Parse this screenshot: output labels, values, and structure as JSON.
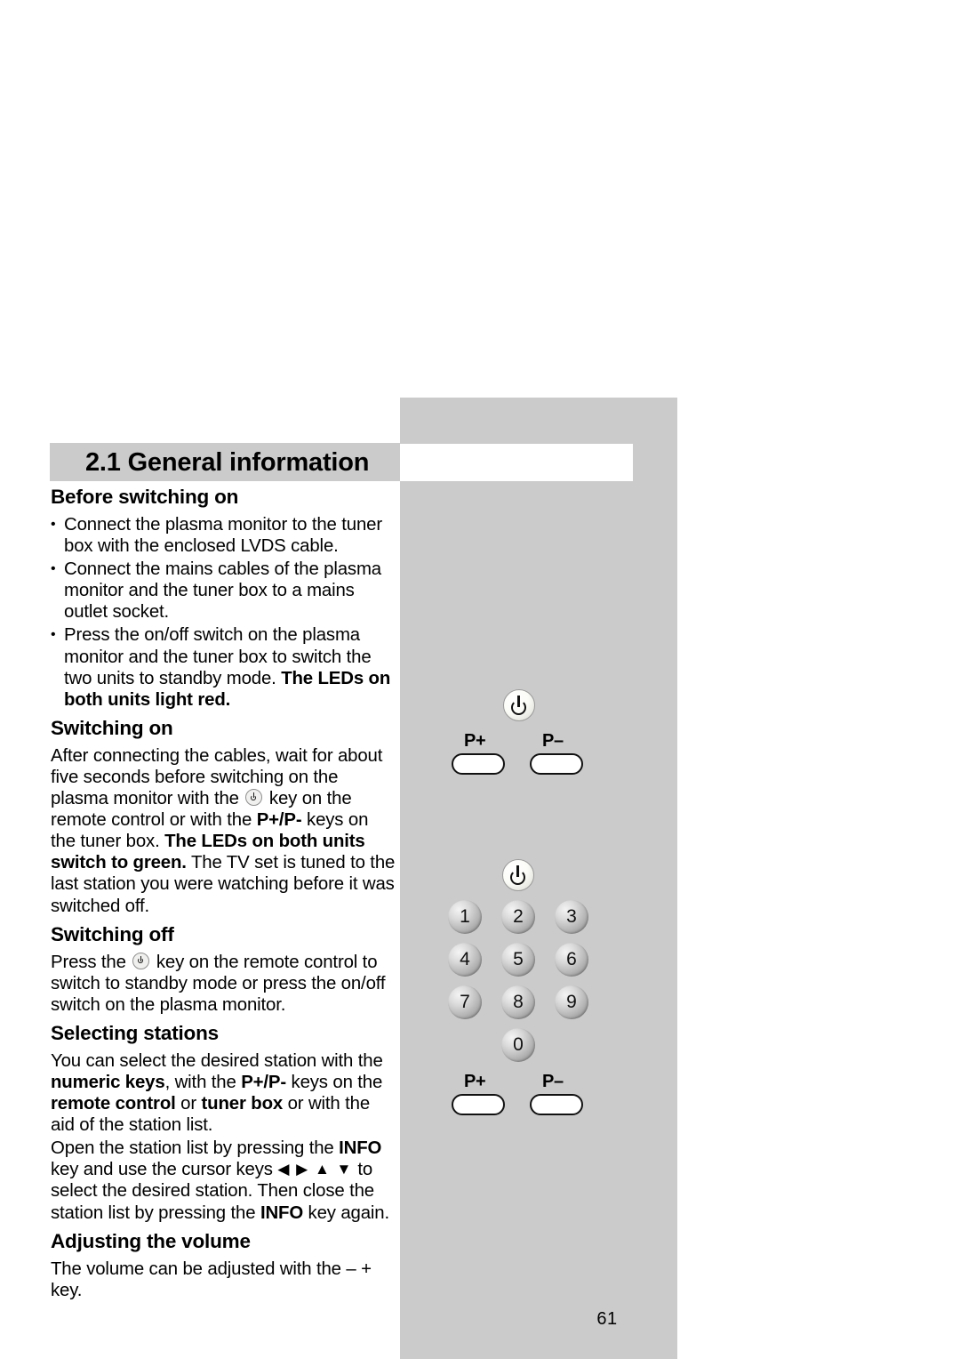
{
  "page": {
    "number": "61",
    "accent_grey": "#cbcbcb"
  },
  "heading": {
    "title": "2.1 General information"
  },
  "sections": [
    {
      "heading": "Before switching on",
      "bullets": [
        "Connect the plasma monitor to the tuner box with the enclosed LVDS cable.",
        "Connect the mains cables of the plasma monitor and the tuner box to a mains outlet socket."
      ],
      "bullet3_plain": "Press the on/off switch on the plasma monitor and the tuner box to switch the two units to standby mode. ",
      "bullet3_bold": "The LEDs on both units light red."
    },
    {
      "heading": "Switching on",
      "p1_a": "After connecting the cables, wait for about five seconds before switching on the plasma monitor with the ",
      "p1_b": " key on the remote control or with the ",
      "p1_c": "P+/P-",
      "p1_d": " keys on the tuner box. ",
      "p1_e": "The LEDs on both units switch to green.",
      "p1_f": " The TV set is tuned to the last station you were watching before it was switched off."
    },
    {
      "heading": "Switching off",
      "p1_a": "Press the ",
      "p1_b": " key on the remote control to switch to standby mode or press the on/off switch on the plasma monitor."
    },
    {
      "heading": "Selecting stations",
      "p1_a": "You can select the desired station with the ",
      "p1_b": "numeric keys",
      "p1_c": ", with the ",
      "p1_d": "P+/P-",
      "p1_e": " keys on the ",
      "p1_f": "remote control",
      "p1_g": " or ",
      "p1_h": "tuner box",
      "p1_i": " or with the aid of the station list.",
      "p2_a": "Open the station list by pressing the ",
      "p2_b": "INFO",
      "p2_c": " key and use the cursor keys ",
      "p2_arrows": "◀ ▶ ▲ ▼",
      "p2_d": " to select the desired station. Then close the station list by pressing the ",
      "p2_e": "INFO",
      "p2_f": " key again."
    },
    {
      "heading": "Adjusting the volume",
      "p1": "The volume can be adjusted with the – + key."
    }
  ],
  "diagrams": {
    "tuner_box": {
      "caption_keys": [
        "P+",
        "P–"
      ],
      "power_key": "power-symbol"
    },
    "remote_control": {
      "power_key": "power-symbol",
      "numeric_keys": [
        "1",
        "2",
        "3",
        "4",
        "5",
        "6",
        "7",
        "8",
        "9",
        "0"
      ],
      "program_keys": [
        "P+",
        "P–"
      ]
    }
  }
}
